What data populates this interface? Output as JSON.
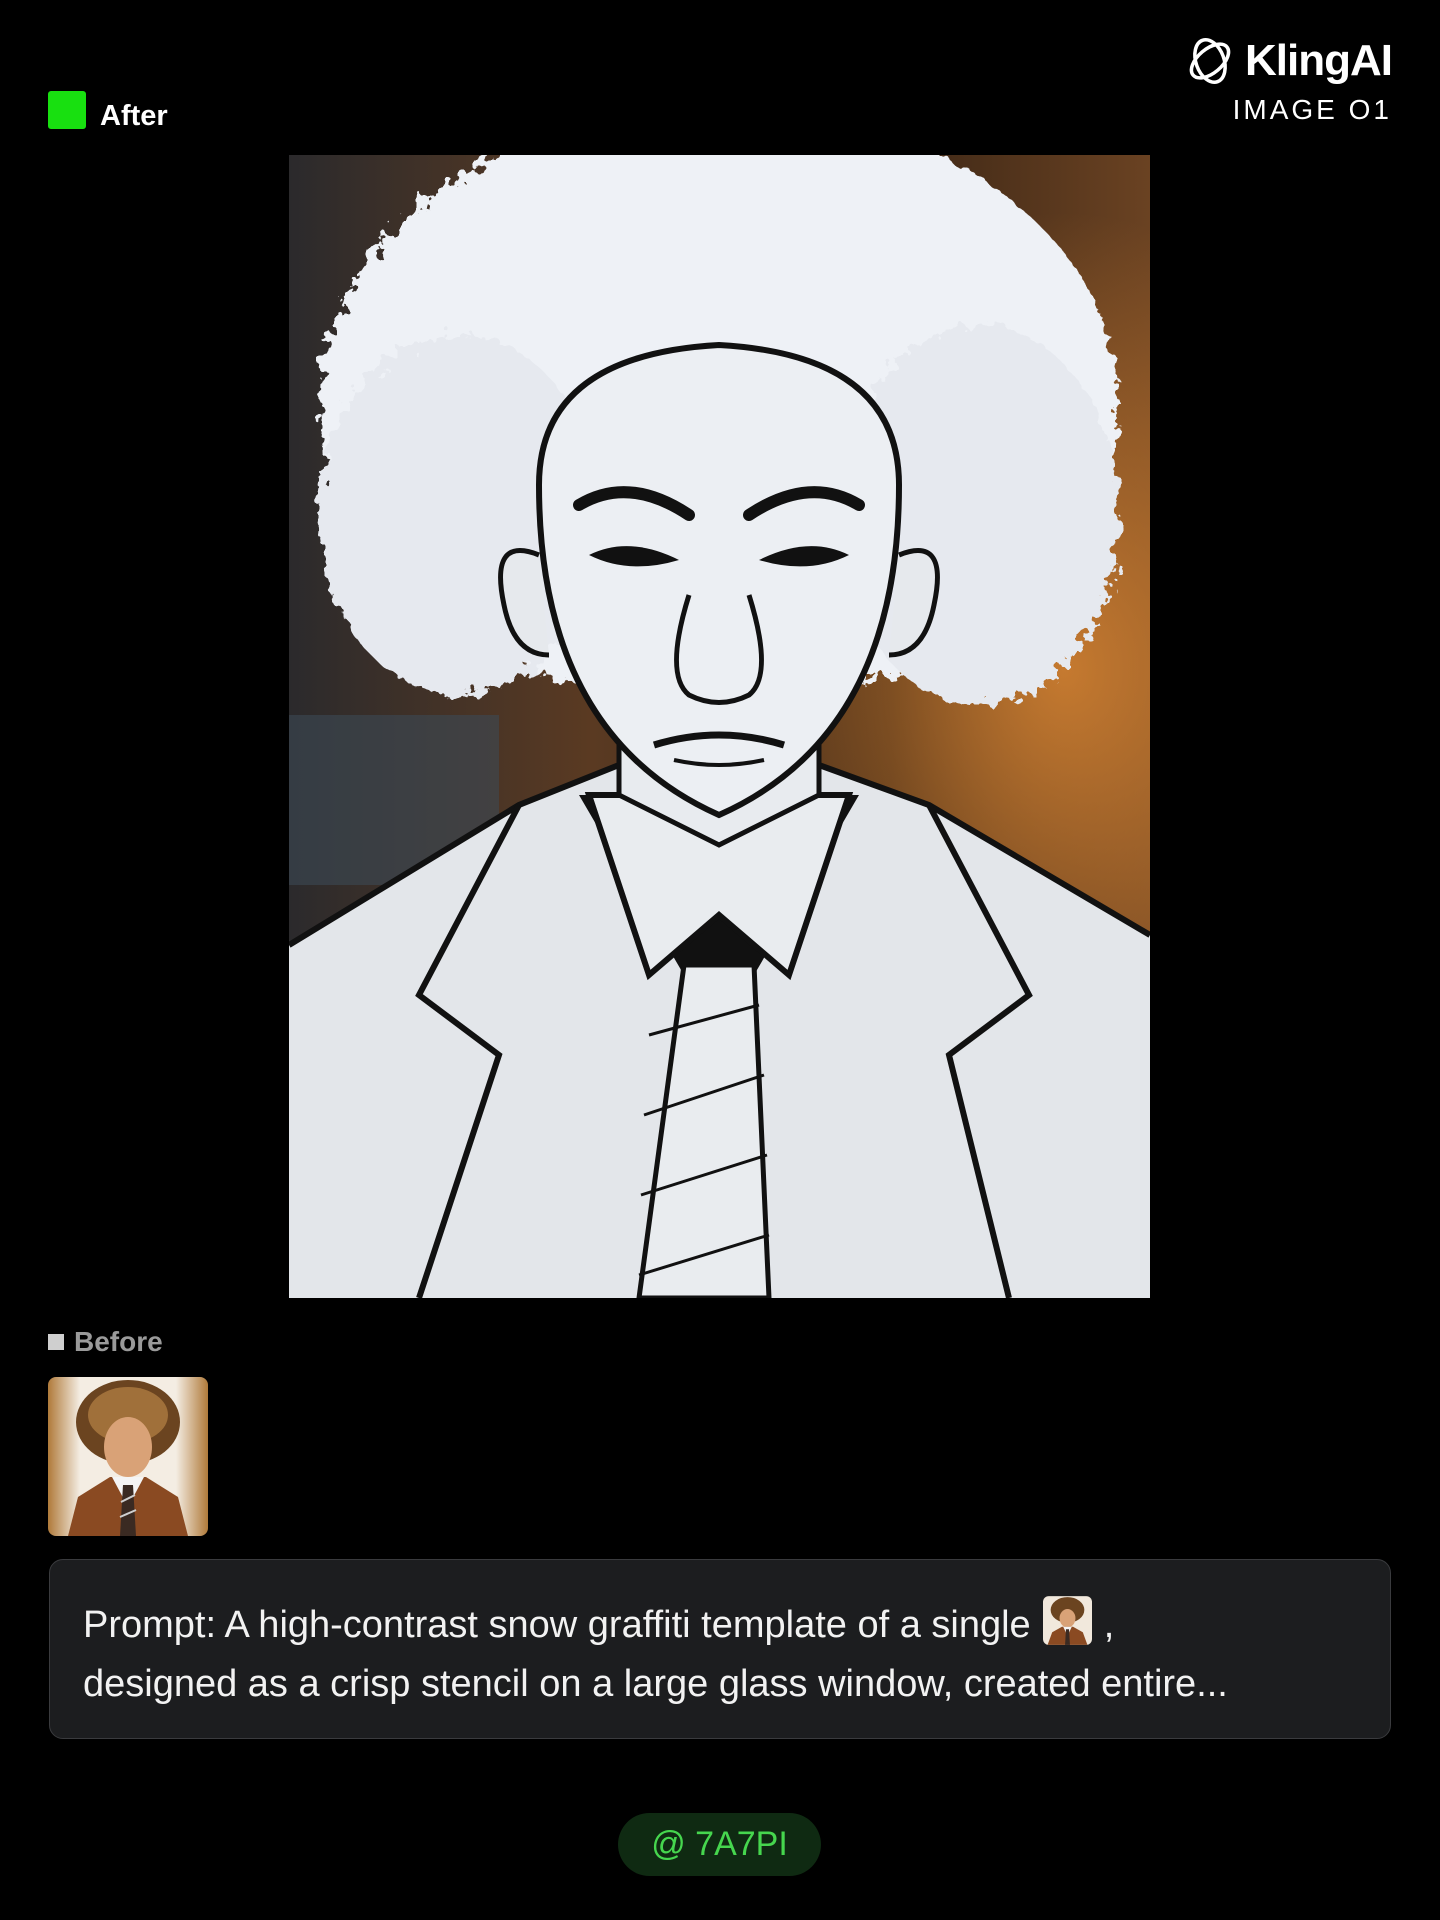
{
  "colors": {
    "accent_green": "#18e010",
    "tag_text": "#46d64e",
    "tag_bg": "#0f2a12",
    "prompt_bg": "#1c1d1f"
  },
  "after": {
    "label": "After",
    "icon": "green-square-icon"
  },
  "brand": {
    "name": "KlingAI",
    "model": "IMAGE O1",
    "icon": "kling-logo-icon"
  },
  "main_image": {
    "description_icon": "snow-stencil-portrait-image"
  },
  "before": {
    "label": "Before",
    "icon": "gray-square-icon"
  },
  "prompt": {
    "line1_before": "Prompt: A high-contrast snow graffiti template of a single",
    "line1_after": ",",
    "line2": "designed as a crisp stencil on a large glass window, created entire..."
  },
  "tag": {
    "label": "@ 7A7PI"
  }
}
